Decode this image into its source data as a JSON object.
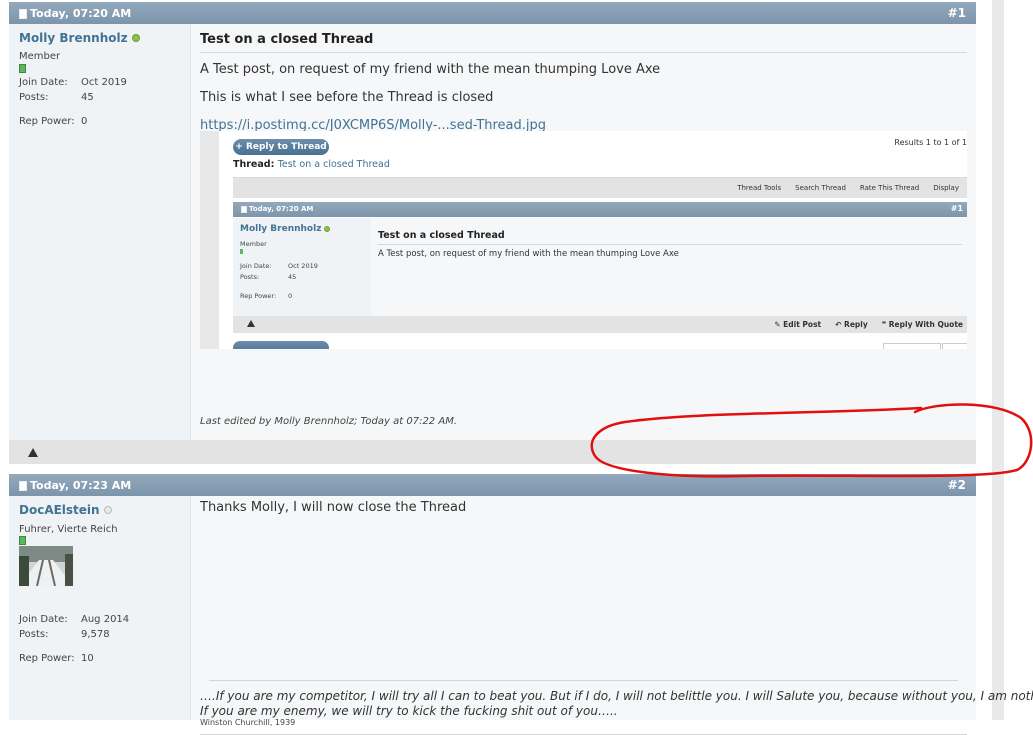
{
  "post1": {
    "date": "Today, 07:20 AM",
    "number": "#1",
    "username": "Molly Brennholz",
    "user_title": "Member",
    "join_label": "Join Date:",
    "join_value": "Oct 2019",
    "posts_label": "Posts:",
    "posts_value": "45",
    "rep_label": "Rep Power:",
    "rep_value": "0",
    "title": "Test on a closed Thread",
    "line1": "A Test post, on request of my friend with the mean thumping Love Axe",
    "line2": "This is what I see before the Thread is closed",
    "link": "https://i.postimg.cc/J0XCMP6S/Molly-...sed-Thread.jpg",
    "edited": "Last edited by Molly Brennholz; Today at 07:22 AM."
  },
  "screenshot": {
    "reply_button": "+ Reply to Thread",
    "results": "Results 1 to 1 of 1",
    "thread_label": "Thread:",
    "thread_name": "Test on a closed Thread",
    "tools": [
      "Thread Tools",
      "Search Thread",
      "Rate This Thread",
      "Display"
    ],
    "date": "Today, 07:20 AM",
    "number": "#1",
    "username": "Molly Brennholz",
    "user_title": "Member",
    "join_label": "Join Date:",
    "join_value": "Oct 2019",
    "posts_label": "Posts:",
    "posts_value": "45",
    "rep_label": "Rep Power:",
    "rep_value": "0",
    "title": "Test on a closed Thread",
    "text": "A Test post, on request of my friend with the mean thumping Love Axe",
    "edit_post": "Edit Post",
    "reply": "Reply",
    "reply_quote": "Reply With Quote"
  },
  "post2": {
    "date": "Today, 07:23 AM",
    "number": "#2",
    "username": "DocAElstein",
    "user_title": "Fuhrer, Vierte Reich",
    "join_label": "Join Date:",
    "join_value": "Aug 2014",
    "posts_label": "Posts:",
    "posts_value": "9,578",
    "rep_label": "Rep Power:",
    "rep_value": "10",
    "text": "Thanks Molly, I will now close the Thread",
    "sig_line1": "….If you are my competitor, I will try all I can to beat you. But if I do, I will not belittle you. I will Salute you, because without you, I am nothing.",
    "sig_line2": "If you are my enemy, we will try to kick the fucking shit out of you…..",
    "sig_small": "Winston Churchill, 1939"
  },
  "colors": {
    "header": "#7d95ab",
    "username": "#417394",
    "annotation": "#e01010"
  }
}
